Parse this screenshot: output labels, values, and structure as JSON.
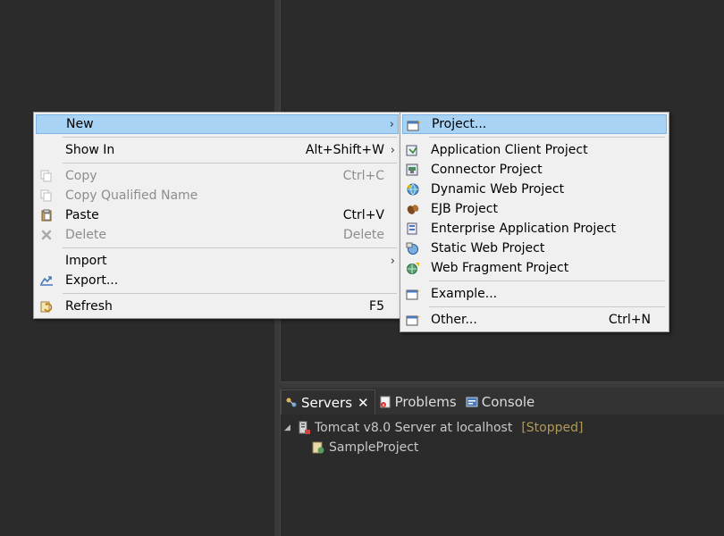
{
  "context_menu": {
    "items": [
      {
        "label": "New",
        "shortcut": "",
        "submenu": true,
        "state": "highlighted"
      },
      {
        "label": "Show In",
        "shortcut": "Alt+Shift+W",
        "submenu": true
      },
      {
        "label": "Copy",
        "shortcut": "Ctrl+C",
        "state": "disabled"
      },
      {
        "label": "Copy Qualified Name",
        "shortcut": "",
        "state": "disabled"
      },
      {
        "label": "Paste",
        "shortcut": "Ctrl+V"
      },
      {
        "label": "Delete",
        "shortcut": "Delete",
        "state": "disabled"
      },
      {
        "label": "Import",
        "shortcut": "",
        "submenu": true
      },
      {
        "label": "Export...",
        "shortcut": ""
      },
      {
        "label": "Refresh",
        "shortcut": "F5"
      }
    ]
  },
  "submenu_new": {
    "items": [
      {
        "label": "Project...",
        "shortcut": "",
        "state": "highlighted"
      },
      {
        "label": "Application Client Project"
      },
      {
        "label": "Connector Project"
      },
      {
        "label": "Dynamic Web Project"
      },
      {
        "label": "EJB Project"
      },
      {
        "label": "Enterprise Application Project"
      },
      {
        "label": "Static Web Project"
      },
      {
        "label": "Web Fragment Project"
      },
      {
        "label": "Example..."
      },
      {
        "label": "Other...",
        "shortcut": "Ctrl+N"
      }
    ]
  },
  "bottom_panel": {
    "tabs": [
      {
        "label": "Servers",
        "active": true,
        "icon": "servers-icon"
      },
      {
        "label": "Problems",
        "active": false,
        "icon": "problems-icon"
      },
      {
        "label": "Console",
        "active": false,
        "icon": "console-icon"
      }
    ],
    "tree": {
      "server": {
        "label": "Tomcat v8.0 Server at localhost",
        "state": "[Stopped]"
      },
      "child": {
        "label": "SampleProject"
      }
    }
  },
  "colors": {
    "highlight": "#a8d3f5",
    "menu_bg": "#f0f0f0",
    "ide_bg": "#2b2b2b",
    "stopped": "#b19a55"
  }
}
